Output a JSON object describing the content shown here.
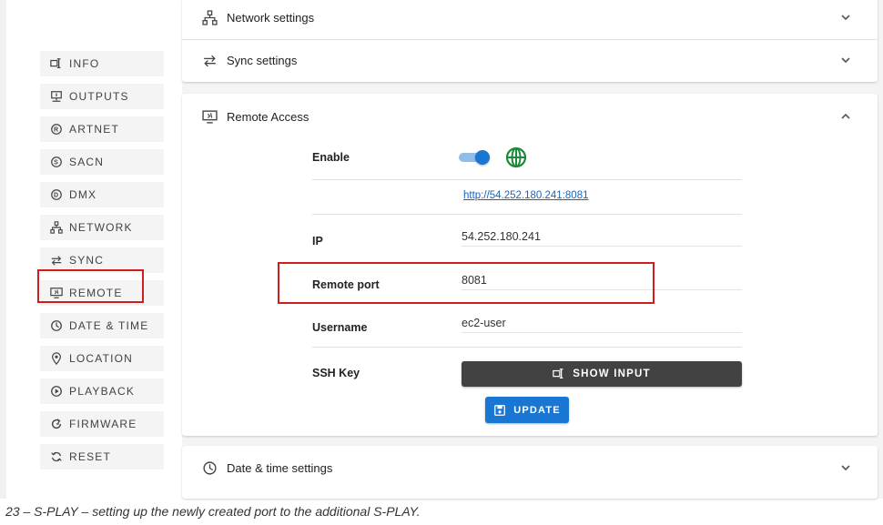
{
  "sidebar": {
    "items": [
      {
        "label": "INFO",
        "icon": "input-icon"
      },
      {
        "label": "OUTPUTS",
        "icon": "output-icon"
      },
      {
        "label": "ARTNET",
        "icon": "artnet-icon"
      },
      {
        "label": "SACN",
        "icon": "sacn-icon"
      },
      {
        "label": "DMX",
        "icon": "dmx-icon"
      },
      {
        "label": "NETWORK",
        "icon": "network-icon"
      },
      {
        "label": "SYNC",
        "icon": "sync-icon"
      },
      {
        "label": "REMOTE",
        "icon": "remote-icon"
      },
      {
        "label": "DATE & TIME",
        "icon": "clock-icon"
      },
      {
        "label": "LOCATION",
        "icon": "location-pin-icon"
      },
      {
        "label": "PLAYBACK",
        "icon": "play-circle-icon"
      },
      {
        "label": "FIRMWARE",
        "icon": "firmware-icon"
      },
      {
        "label": "RESET",
        "icon": "reset-icon"
      }
    ]
  },
  "panels": {
    "network": {
      "title": "Network settings"
    },
    "sync": {
      "title": "Sync settings"
    },
    "remote": {
      "title": "Remote Access",
      "enable_label": "Enable",
      "enable_state": "on",
      "url": "http://54.252.180.241:8081",
      "ip_label": "IP",
      "ip_value": "54.252.180.241",
      "port_label": "Remote port",
      "port_value": "8081",
      "username_label": "Username",
      "username_value": "ec2-user",
      "ssh_label": "SSH Key",
      "show_input_label": "SHOW INPUT",
      "update_label": "UPDATE"
    },
    "datetime": {
      "title": "Date & time settings"
    }
  },
  "caption": "23 – S-PLAY – setting up the newly created port to the additional S-PLAY.",
  "colors": {
    "accent": "#1976d2",
    "highlight": "#d01e1e",
    "globe": "#1b8a3a",
    "dark_button": "#424242"
  }
}
